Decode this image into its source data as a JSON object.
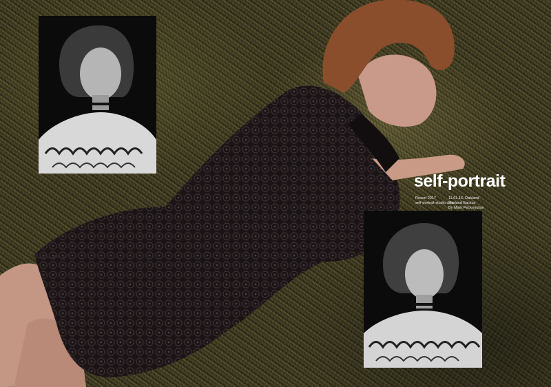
{
  "brand": {
    "wordmark": "self-portrait"
  },
  "details": {
    "season": "Resort 2017",
    "website": "self-portrait-studio.com",
    "date_location": "11.01.16, Oakland",
    "model": "Marland Backus",
    "photographer": "By Mark Peckmezian"
  },
  "colors": {
    "grass": "#4a4526",
    "dress": "#1a1416",
    "hair": "#8a4e2c",
    "skin": "#c99a86",
    "inset_bg": "#0b0b0b",
    "text": "#ffffff"
  }
}
